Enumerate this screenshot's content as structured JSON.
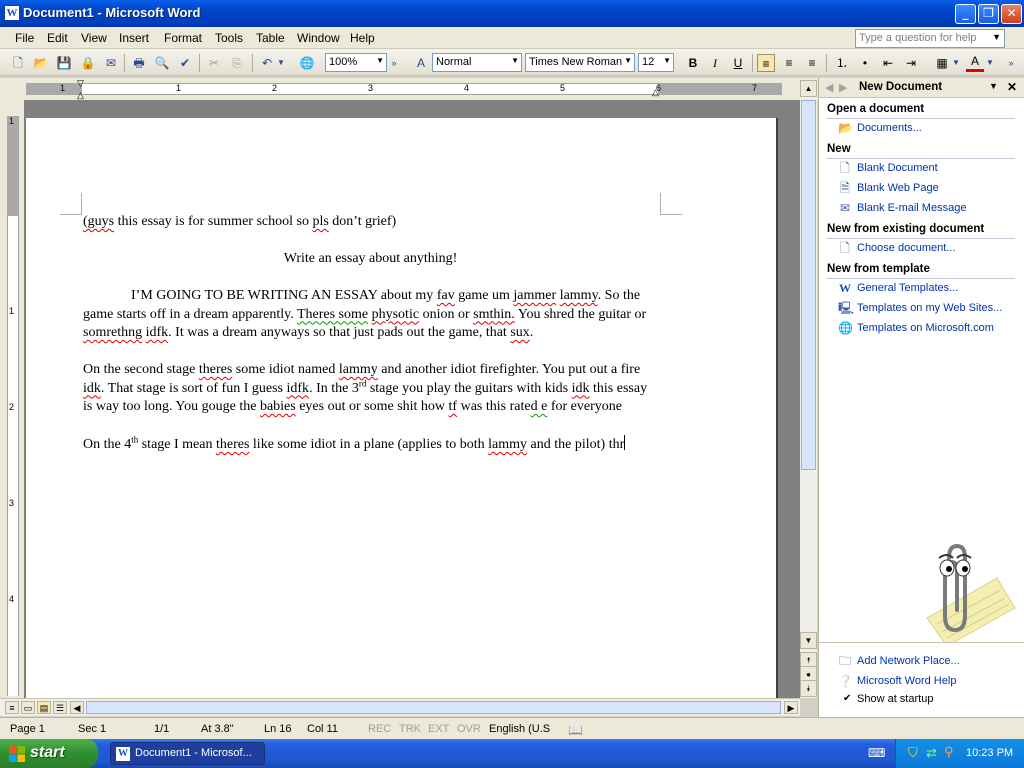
{
  "window": {
    "title": "Document1 - Microsoft Word",
    "icon": "W"
  },
  "menu": [
    "File",
    "Edit",
    "View",
    "Insert",
    "Format",
    "Tools",
    "Table",
    "Window",
    "Help"
  ],
  "help_box": {
    "placeholder": "Type a question for help"
  },
  "toolbar": {
    "zoom": "100%",
    "style": "Normal",
    "font": "Times New Roman",
    "size": "12",
    "bold": "B",
    "italic": "I",
    "underline": "U",
    "font_color": "A"
  },
  "ruler": {
    "numbers": [
      "1",
      "1",
      "2",
      "3",
      "4",
      "5",
      "6",
      "7"
    ]
  },
  "vruler": {
    "numbers": [
      "1",
      "1",
      "2",
      "3",
      "4"
    ]
  },
  "document": {
    "p1": "(guys this essay is for summer school so pls don’t grief)",
    "p2": "Write an essay about anything!",
    "p3": {
      "a": "I’M GOING TO BE WRITING AN ESSAY about my ",
      "fav": "fav",
      "b": " game um ",
      "jammer": "jammer",
      "c": " ",
      "lammy": "lammy",
      "d": ". So the game starts off in a dream apparently. ",
      "theres": "Theres some",
      "e": " ",
      "physotic": "physotic",
      "f": " onion or ",
      "smthin": "smthin.",
      "g": " You shred the guitar or ",
      "somrethng": "somrethng",
      "h": " ",
      "idfk": "idfk",
      "i": ". It was a dream anyways so that just pads out the game, that ",
      "sux": "sux",
      "j": "."
    },
    "p4": {
      "a": "On the second stage ",
      "theres": "theres",
      "b": " some idiot named ",
      "lammy": "lammy",
      "c": " and another idiot firefighter.  You put out a fire ",
      "idk1": "idk",
      "d": ". That stage is sort of fun I guess ",
      "idfk": "idfk",
      "e": ". In the 3",
      "rd": "rd",
      "f": " stage you play the guitars with kids ",
      "idk2": "idk",
      "g": " this essay is way too long.  You gouge the ",
      "babies": "babies",
      "h": " eyes out or some shit how ",
      "tf": "tf",
      "i": " was this rate",
      "j": "d e",
      "k": " for everyone"
    },
    "p5": {
      "a": "On the 4",
      "th": "th",
      "b": " stage I mean ",
      "theres": "theres",
      "c": " like some idiot in a plane (applies to both ",
      "lammy": "lammy",
      "d": " and the pilot) ",
      "thr": "thr"
    }
  },
  "status": {
    "page": "Page  1",
    "sec": "Sec  1",
    "pages": "1/1",
    "at": "At  3.8\"",
    "ln": "Ln  16",
    "col": "Col  11",
    "rec": "REC",
    "trk": "TRK",
    "ext": "EXT",
    "ovr": "OVR",
    "lang": "English (U.S"
  },
  "task_pane": {
    "title": "New Document",
    "sections": [
      {
        "heading": "Open a document",
        "links": [
          "Documents..."
        ]
      },
      {
        "heading": "New",
        "links": [
          "Blank Document",
          "Blank Web Page",
          "Blank E-mail Message"
        ]
      },
      {
        "heading": "New from existing document",
        "links": [
          "Choose document..."
        ]
      },
      {
        "heading": "New from template",
        "links": [
          "General Templates...",
          "Templates on my Web Sites...",
          "Templates on Microsoft.com"
        ]
      }
    ],
    "bottom_links": [
      "Add Network Place...",
      "Microsoft Word Help"
    ],
    "show_at_startup": "Show at startup"
  },
  "taskbar": {
    "start": "start",
    "app": "Document1 - Microsof...",
    "clock": "10:23 PM"
  }
}
